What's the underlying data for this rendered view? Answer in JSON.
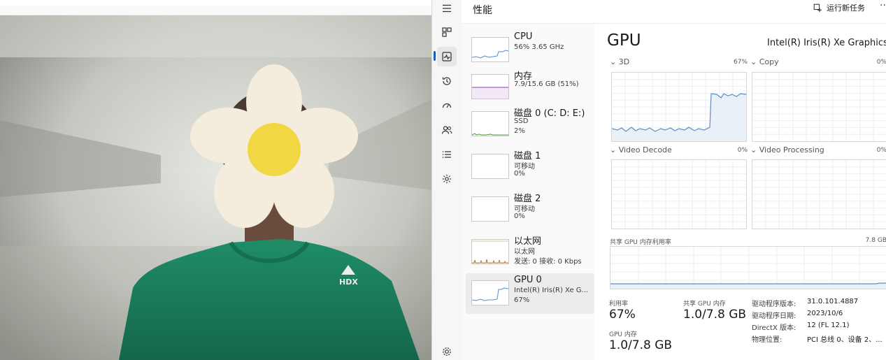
{
  "window": {
    "section_title": "性能",
    "run_task_label": "运行新任务",
    "more": "···"
  },
  "sidebar": {
    "items": [
      {
        "name": "CPU",
        "line2": "56% 3.65 GHz",
        "line3": ""
      },
      {
        "name": "内存",
        "line2": "7.9/15.6 GB (51%)",
        "line3": ""
      },
      {
        "name": "磁盘 0 (C: D: E:)",
        "line2": "SSD",
        "line3": "2%"
      },
      {
        "name": "磁盘 1",
        "line2": "可移动",
        "line3": "0%"
      },
      {
        "name": "磁盘 2",
        "line2": "可移动",
        "line3": "0%"
      },
      {
        "name": "以太网",
        "line2": "以太网",
        "line3": "发送: 0 接收: 0 Kbps"
      },
      {
        "name": "GPU 0",
        "line2": "Intel(R) Iris(R) Xe G...",
        "line3": "67%"
      }
    ]
  },
  "main": {
    "title": "GPU",
    "device": "Intel(R) Iris(R) Xe Graphics",
    "engines": [
      {
        "label": "3D",
        "pct": "67%"
      },
      {
        "label": "Copy",
        "pct": "0%"
      },
      {
        "label": "Video Decode",
        "pct": "0%"
      },
      {
        "label": "Video Processing",
        "pct": "0%"
      }
    ],
    "shared_memory": {
      "label": "共享 GPU 内存利用率",
      "max": "7.8 GB"
    },
    "stats": {
      "util_label": "利用率",
      "util_value": "67%",
      "shared_label": "共享 GPU 内存",
      "shared_value": "1.0/7.8 GB",
      "gpu_mem_label": "GPU 内存",
      "gpu_mem_value": "1.0/7.8 GB"
    },
    "details": [
      {
        "k": "驱动程序版本:",
        "v": "31.0.101.4887"
      },
      {
        "k": "驱动程序日期:",
        "v": "2023/10/6"
      },
      {
        "k": "DirectX 版本:",
        "v": "12 (FL 12.1)"
      },
      {
        "k": "物理位置:",
        "v": "PCI 总线 0、设备 2、..."
      }
    ]
  },
  "colors": {
    "accent": "#1a5fb4",
    "graph_line": "#5b8dc7",
    "memory_line": "#8a3fb0",
    "disk_line": "#4f9a3c",
    "net_line": "#b0782a"
  },
  "icons": [
    "menu-icon",
    "processes-icon",
    "performance-icon",
    "app-history-icon",
    "startup-icon",
    "users-icon",
    "details-icon",
    "services-icon",
    "settings-icon",
    "run-task-icon"
  ]
}
